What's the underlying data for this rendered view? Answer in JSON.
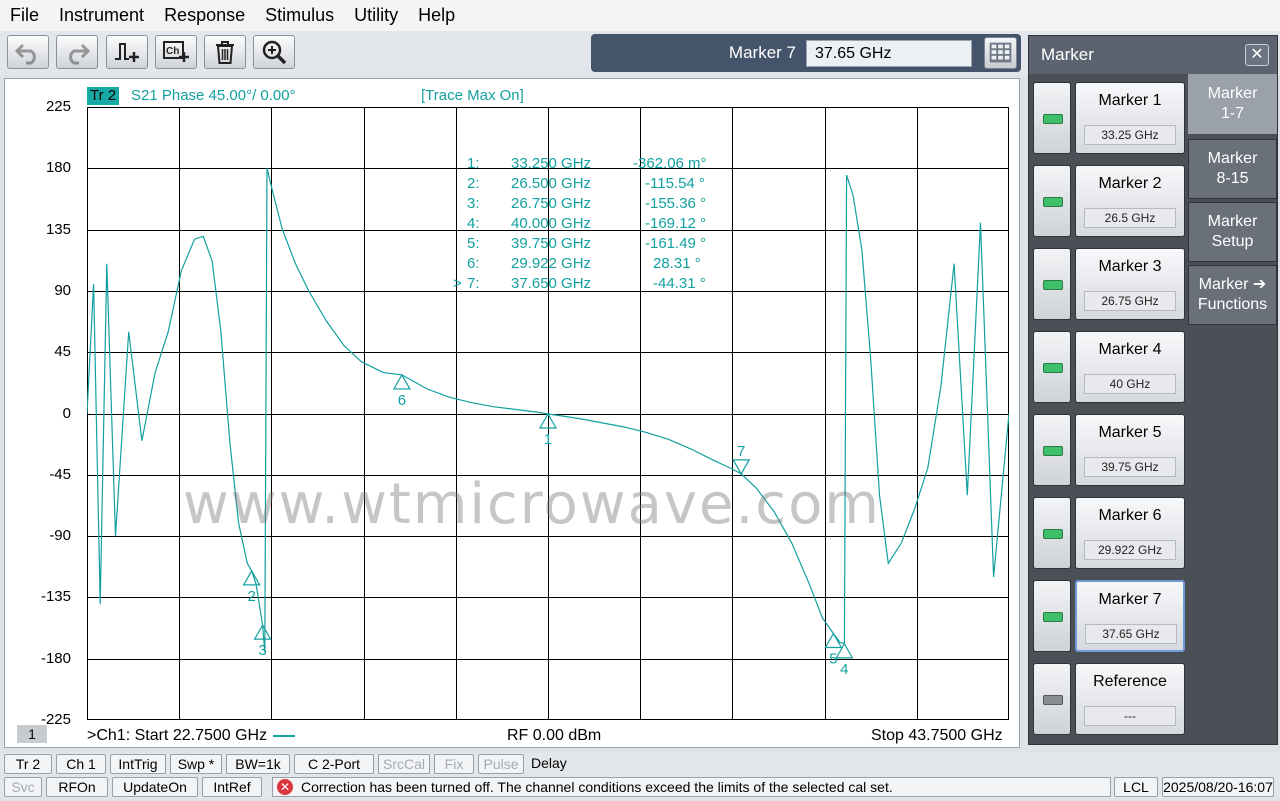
{
  "menu": [
    "File",
    "Instrument",
    "Response",
    "Stimulus",
    "Utility",
    "Help"
  ],
  "toolbar_icons": [
    "undo-icon",
    "redo-icon",
    "add-trace-icon",
    "add-channel-icon",
    "delete-icon",
    "zoom-icon"
  ],
  "entry": {
    "label": "Marker 7",
    "value": "37.65 GHz"
  },
  "trace": {
    "badge": "Tr 2",
    "title": "S21 Phase 45.00°/  0.00°",
    "status": "[Trace Max On]"
  },
  "channel_badge": "1",
  "footer": {
    "start": ">Ch1:  Start  22.7500 GHz",
    "rf": "RF    0.00 dBm",
    "stop": "Stop  43.7500 GHz"
  },
  "watermark": "www.wtmicrowave.com",
  "markers_table": [
    {
      "prefix": "",
      "num": "1:",
      "freq": "33.250  GHz",
      "val": "-362.06 m°"
    },
    {
      "prefix": "",
      "num": "2:",
      "freq": "26.500  GHz",
      "val": "-115.54 °"
    },
    {
      "prefix": "",
      "num": "3:",
      "freq": "26.750  GHz",
      "val": "-155.36 °"
    },
    {
      "prefix": "",
      "num": "4:",
      "freq": "40.000  GHz",
      "val": "-169.12 °"
    },
    {
      "prefix": "",
      "num": "5:",
      "freq": "39.750  GHz",
      "val": "-161.49 °"
    },
    {
      "prefix": "",
      "num": "6:",
      "freq": "29.922  GHz",
      "val": "28.31 °"
    },
    {
      "prefix": ">",
      "num": "7:",
      "freq": "37.650  GHz",
      "val": "-44.31 °"
    }
  ],
  "panel": {
    "title": "Marker",
    "close": "✕",
    "markers": [
      {
        "label": "Marker 1",
        "value": "33.25 GHz",
        "on": true
      },
      {
        "label": "Marker 2",
        "value": "26.5 GHz",
        "on": true
      },
      {
        "label": "Marker 3",
        "value": "26.75 GHz",
        "on": true
      },
      {
        "label": "Marker 4",
        "value": "40 GHz",
        "on": true
      },
      {
        "label": "Marker 5",
        "value": "39.75 GHz",
        "on": true
      },
      {
        "label": "Marker 6",
        "value": "29.922 GHz",
        "on": true
      },
      {
        "label": "Marker 7",
        "value": "37.65 GHz",
        "on": true,
        "active": true
      },
      {
        "label": "Reference",
        "value": "---",
        "on": false
      }
    ],
    "tabs": [
      {
        "label": "Marker\n1-7",
        "active": true
      },
      {
        "label": "Marker\n8-15"
      },
      {
        "label": "Marker\nSetup"
      },
      {
        "label": "Marker ➔\nFunctions"
      }
    ]
  },
  "status1": [
    "Tr 2",
    "Ch 1",
    "IntTrig",
    "Swp *",
    "BW=1k",
    "C  2-Port",
    "SrcCal",
    "Fix",
    "Pulse",
    "Delay"
  ],
  "status1_dim": [
    false,
    false,
    false,
    false,
    false,
    false,
    true,
    true,
    true,
    false
  ],
  "status2": [
    "Svc",
    "RFOn",
    "UpdateOn",
    "IntRef"
  ],
  "status2_dim": [
    true,
    false,
    false,
    false
  ],
  "message": "Correction has been turned off. The channel conditions exceed the limits of the selected cal set.",
  "lcl": "LCL",
  "datetime": "2025/08/20-16:07",
  "chart_data": {
    "type": "line",
    "ylim": [
      -225,
      225
    ],
    "xlim": [
      22.75,
      43.75
    ],
    "yticks": [
      225,
      180,
      135,
      90,
      45,
      0,
      -45,
      -90,
      -135,
      -180,
      -225
    ],
    "grid": true,
    "series": [
      {
        "x": [
          22.75,
          22.9,
          23.05,
          23.2,
          23.4,
          23.7,
          24.0,
          24.3,
          24.6,
          24.9,
          25.2,
          25.4,
          25.6,
          25.8,
          26.0,
          26.2,
          26.4,
          26.5,
          26.6,
          26.75,
          26.8,
          26.85,
          27.0,
          27.2,
          27.5,
          27.8,
          28.2,
          28.6,
          29.0,
          29.5,
          29.922,
          30.5,
          31.0,
          31.5,
          32.0,
          32.5,
          33.0,
          33.25,
          33.5,
          34.0,
          34.5,
          35.0,
          35.5,
          36.0,
          36.5,
          37.0,
          37.4,
          37.65,
          38.0,
          38.4,
          38.8,
          39.2,
          39.5,
          39.75,
          39.9,
          40.0,
          40.05,
          40.2,
          40.4,
          40.6,
          40.8,
          41.0,
          41.3,
          41.6,
          41.9,
          42.2,
          42.5,
          42.8,
          43.1,
          43.4,
          43.75
        ],
        "y": [
          0,
          95,
          -140,
          110,
          -90,
          60,
          -20,
          30,
          60,
          105,
          128,
          130,
          112,
          60,
          -20,
          -80,
          -110,
          -115.5,
          -125,
          -155.4,
          -175,
          180,
          160,
          135,
          110,
          90,
          68,
          50,
          38,
          30,
          28.3,
          18,
          12,
          8,
          5,
          3,
          1,
          -0.4,
          -1.5,
          -4,
          -7,
          -10,
          -14,
          -19,
          -26,
          -34,
          -40,
          -44.3,
          -55,
          -72,
          -95,
          -125,
          -150,
          -161.5,
          -168,
          -169,
          175,
          160,
          120,
          40,
          -60,
          -110,
          -95,
          -70,
          -40,
          20,
          110,
          -60,
          140,
          -120,
          0
        ]
      }
    ],
    "markers": [
      {
        "id": "1",
        "x": 33.25,
        "y": -0.36
      },
      {
        "id": "2",
        "x": 26.5,
        "y": -115.54
      },
      {
        "id": "3",
        "x": 26.75,
        "y": -155.36
      },
      {
        "id": "4",
        "x": 40.0,
        "y": -169.12
      },
      {
        "id": "5",
        "x": 39.75,
        "y": -161.49
      },
      {
        "id": "6",
        "x": 29.922,
        "y": 28.31
      },
      {
        "id": "7",
        "x": 37.65,
        "y": -44.31
      }
    ],
    "trace_color": "#13a0a0"
  }
}
